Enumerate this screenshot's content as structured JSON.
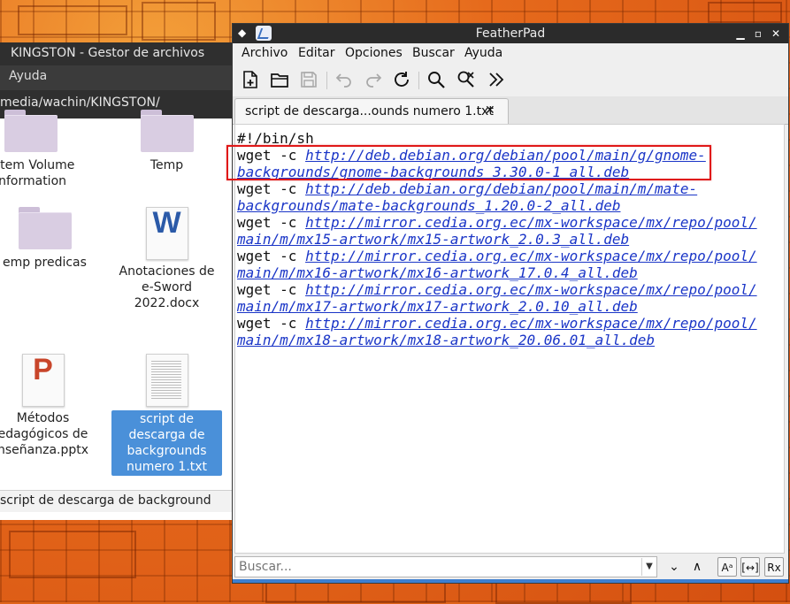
{
  "file_manager": {
    "title": "KINGSTON - Gestor de archivos",
    "menu": [
      "Ayuda"
    ],
    "path": "media/wachin/KINGSTON/",
    "items": [
      {
        "label": "ystem Volume\nInformation",
        "kind": "folder"
      },
      {
        "label": "Temp",
        "kind": "folder"
      },
      {
        "label": "emp predicas",
        "kind": "folder"
      },
      {
        "label": "Anotaciones de\ne-Sword\n2022.docx",
        "kind": "word"
      },
      {
        "label": "Métodos\nedagógicos de\nnseñanza.pptx",
        "kind": "ppt"
      },
      {
        "label": "script de\ndescarga de\nbackgrounds\nnumero 1.txt",
        "kind": "txt",
        "selected": true
      }
    ],
    "status": "script de descarga de background"
  },
  "featherpad": {
    "title": "FeatherPad",
    "menu": [
      "Archivo",
      "Editar",
      "Opciones",
      "Buscar",
      "Ayuda"
    ],
    "toolbar": [
      "new-file",
      "open-folder",
      "save",
      "undo",
      "redo",
      "reload",
      "find",
      "find-replace",
      "more"
    ],
    "tab": {
      "label": "script de descarga...ounds numero 1.txt",
      "close": "✕"
    },
    "code": [
      {
        "prefix": "#!/bin/sh",
        "link": ""
      },
      {
        "prefix": "wget -c ",
        "link": "http://deb.debian.org/debian/pool/main/g/gnome-"
      },
      {
        "prefix": "",
        "link": "backgrounds/gnome-backgrounds_3.30.0-1_all.deb"
      },
      {
        "prefix": "wget -c ",
        "link": "http://deb.debian.org/debian/pool/main/m/mate-"
      },
      {
        "prefix": "",
        "link": "backgrounds/mate-backgrounds_1.20.0-2_all.deb"
      },
      {
        "prefix": "wget -c ",
        "link": "http://mirror.cedia.org.ec/mx-workspace/mx/repo/pool/"
      },
      {
        "prefix": "",
        "link": "main/m/mx15-artwork/mx15-artwork_2.0.3_all.deb"
      },
      {
        "prefix": "wget -c ",
        "link": "http://mirror.cedia.org.ec/mx-workspace/mx/repo/pool/"
      },
      {
        "prefix": "",
        "link": "main/m/mx16-artwork/mx16-artwork_17.0.4_all.deb"
      },
      {
        "prefix": "wget -c ",
        "link": "http://mirror.cedia.org.ec/mx-workspace/mx/repo/pool/"
      },
      {
        "prefix": "",
        "link": "main/m/mx17-artwork/mx17-artwork_2.0.10_all.deb"
      },
      {
        "prefix": "wget -c ",
        "link": "http://mirror.cedia.org.ec/mx-workspace/mx/repo/pool/"
      },
      {
        "prefix": "",
        "link": "main/m/mx18-artwork/mx18-artwork_20.06.01_all.deb"
      }
    ],
    "search": {
      "placeholder": "Buscar...",
      "buttons": [
        "⌄",
        "∧",
        "Aᵃ",
        "[↔]",
        "Rx"
      ]
    },
    "colors": {
      "link": "#1a35c7",
      "highlight": "#e01818",
      "accent": "#3d7fd1"
    }
  }
}
